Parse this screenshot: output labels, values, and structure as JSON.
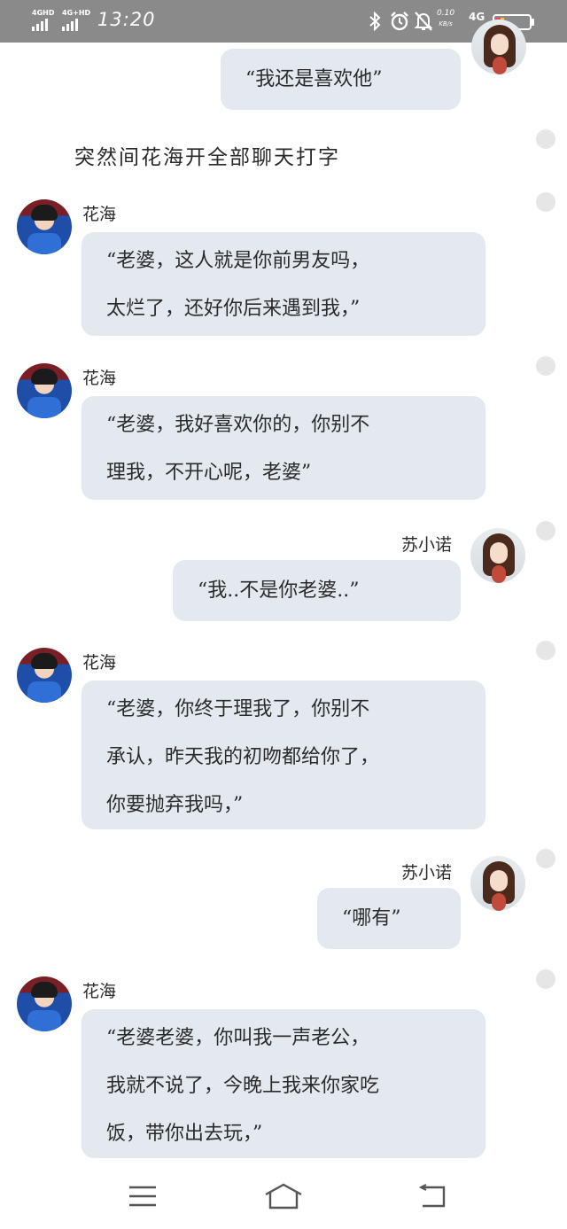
{
  "status_bar": {
    "signal1_label": "4GHD",
    "signal2_label": "4G+HD",
    "time": "13:20",
    "net_speed_value": "0.10",
    "net_speed_unit": "KB/s",
    "network_type": "4G",
    "battery_level": 0.15
  },
  "chat": {
    "top_bubble": "“我还是喜欢他”",
    "narration": "突然间花海开全部聊天打字",
    "messages": [
      {
        "sender": "花海",
        "text": "“老婆，这人就是你前男友吗，\n太烂了，还好你后来遇到我，”"
      },
      {
        "sender": "花海",
        "text": "“老婆，我好喜欢你的，你别不\n理我，不开心呢，老婆”"
      },
      {
        "sender": "苏小诺",
        "text": "“我..不是你老婆..”"
      },
      {
        "sender": "花海",
        "text": "“老婆，你终于理我了，你别不\n承认，昨天我的初吻都给你了，\n你要抛弃我吗，”"
      },
      {
        "sender": "苏小诺",
        "text": "“哪有”"
      },
      {
        "sender": "花海",
        "text": "“老婆老婆，你叫我一声老公，\n我就不说了，今晚上我来你家吃\n饭，带你出去玩，”"
      }
    ]
  },
  "nav": {
    "menu_icon": "menu-icon",
    "home_icon": "home-icon",
    "back_icon": "back-icon"
  }
}
